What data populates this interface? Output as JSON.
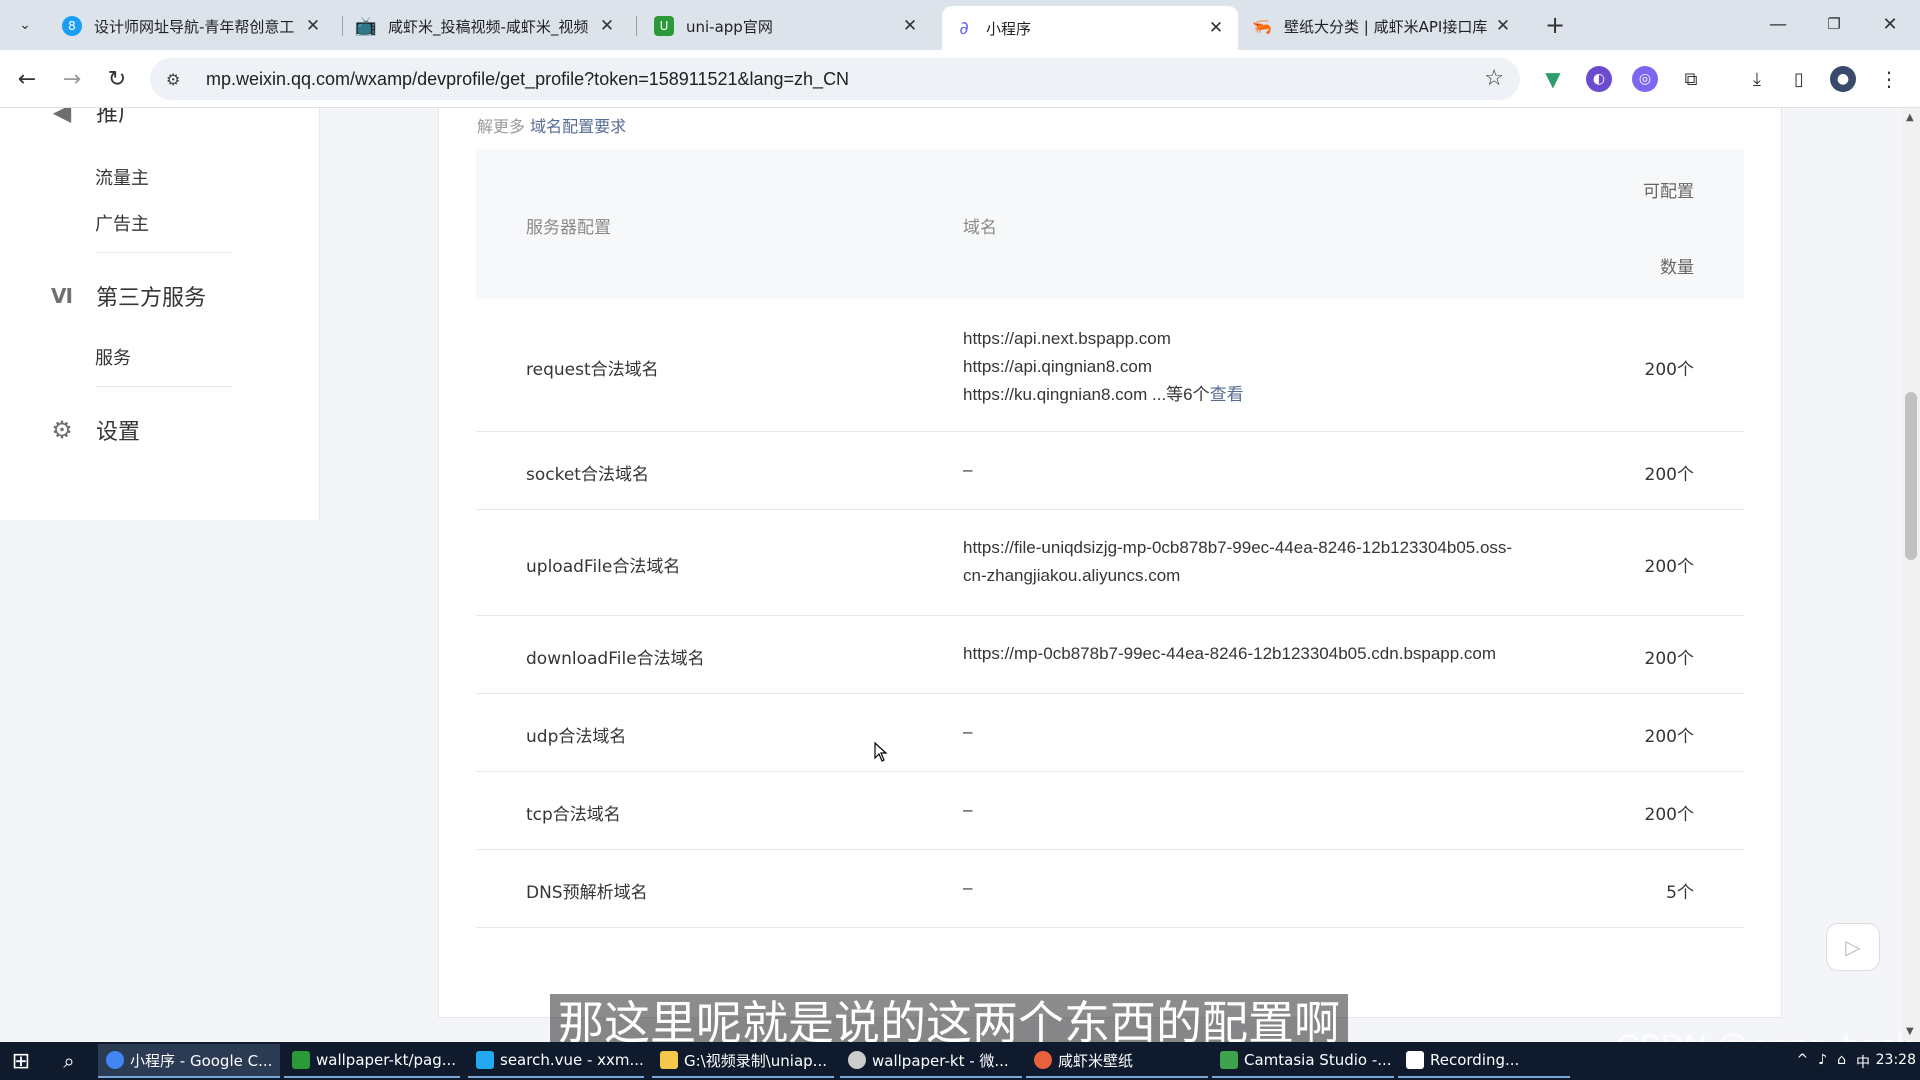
{
  "browser": {
    "tabs": [
      {
        "title": "设计师网址导航-青年帮创意工",
        "icon": "8",
        "color": "#1a9ef5"
      },
      {
        "title": "咸虾米_投稿视频-咸虾米_视频",
        "icon": "tv-icon",
        "color": "#00a1d6"
      },
      {
        "title": "uni-app官网",
        "icon": "U",
        "color": "#2b9939"
      },
      {
        "title": "小程序",
        "icon": "miniprogram-icon",
        "color": "#6467f0"
      },
      {
        "title": "壁纸大分类 | 咸虾米API接口库",
        "icon": "shrimp-icon",
        "color": "#e8603c"
      }
    ],
    "active_tab": 3,
    "url": "mp.weixin.qq.com/wxamp/devprofile/get_profile?token=158911521&lang=zh_CN"
  },
  "sidebar": {
    "partial_category": "推广",
    "promo_items": [
      "流量主",
      "广告主"
    ],
    "third_party": {
      "label": "第三方服务",
      "items": [
        "服务"
      ]
    },
    "settings": {
      "label": "设置"
    }
  },
  "panel": {
    "hint_text": "解更多",
    "hint_link": "域名配置要求",
    "headers": {
      "server": "服务器配置",
      "domain": "域名",
      "count_line1": "可配置",
      "count_line2": "数量"
    },
    "rows": [
      {
        "name": "request合法域名",
        "domains": [
          "https://api.next.bspapp.com",
          "https://api.qingnian8.com",
          "https://ku.qingnian8.com ...等6个"
        ],
        "view": "查看",
        "count": "200个"
      },
      {
        "name": "socket合法域名",
        "domains": [
          "–"
        ],
        "view": "",
        "count": "200个"
      },
      {
        "name": "uploadFile合法域名",
        "domains": [
          "https://file-uniqdsizjg-mp-0cb878b7-99ec-44ea-8246-12b123304b05.oss-",
          "cn-zhangjiakou.aliyuncs.com"
        ],
        "view": "",
        "count": "200个"
      },
      {
        "name": "downloadFile合法域名",
        "domains": [
          "https://mp-0cb878b7-99ec-44ea-8246-12b123304b05.cdn.bspapp.com"
        ],
        "view": "",
        "count": "200个"
      },
      {
        "name": "udp合法域名",
        "domains": [
          "–"
        ],
        "view": "",
        "count": "200个"
      },
      {
        "name": "tcp合法域名",
        "domains": [
          "–"
        ],
        "view": "",
        "count": "200个"
      },
      {
        "name": "DNS预解析域名",
        "domains": [
          "–"
        ],
        "view": "",
        "count": "5个"
      }
    ]
  },
  "overlay": {
    "subtitle": "那这里呢就是说的这两个东西的配置啊",
    "watermark": "CSDN @wang_book"
  },
  "taskbar": {
    "items": [
      {
        "label": "小程序 - Google C...",
        "color": "#4285f4"
      },
      {
        "label": "wallpaper-kt/pag...",
        "color": "#2b9939"
      },
      {
        "label": "search.vue - xxm...",
        "color": "#23a9f2"
      },
      {
        "label": "G:\\视频录制\\uniap...",
        "color": "#f2c94c"
      },
      {
        "label": "wallpaper-kt - 微...",
        "color": "#cccccc"
      },
      {
        "label": "咸虾米壁纸",
        "color": "#e8603c"
      },
      {
        "label": "Camtasia Studio -...",
        "color": "#3fa34d"
      },
      {
        "label": "Recording...",
        "color": "#ffffff"
      }
    ],
    "clock": "23:28"
  }
}
